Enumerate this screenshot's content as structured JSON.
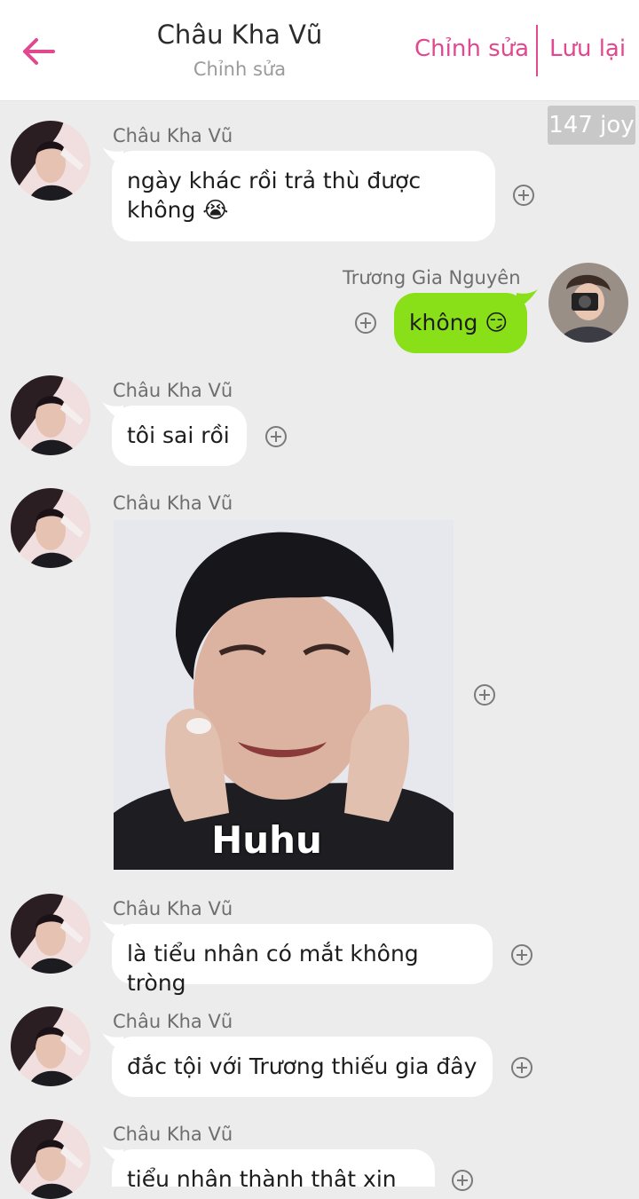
{
  "header": {
    "title": "Châu Kha Vũ",
    "subtitle": "Chỉnh sửa",
    "edit_label": "Chỉnh sửa",
    "save_label": "Lưu lại"
  },
  "joy_badge": "147 joy",
  "colors": {
    "accent": "#e0488f",
    "my_bubble": "#89e018",
    "background": "#ececec"
  },
  "messages": [
    {
      "sender": "Châu Kha Vũ",
      "text": "ngày khác rồi trả thù được không 😭"
    },
    {
      "sender": "Trương Gia Nguyên",
      "text": "không 😏"
    },
    {
      "sender": "Châu Kha Vũ",
      "text": "tôi sai rồi"
    },
    {
      "sender": "Châu Kha Vũ",
      "image_caption": "Huhu"
    },
    {
      "sender": "Châu Kha Vũ",
      "text": "là tiểu nhân có mắt không tròng"
    },
    {
      "sender": "Châu Kha Vũ",
      "text": "đắc tội với Trương thiếu gia đây"
    },
    {
      "sender": "Châu Kha Vũ",
      "text": "tiểu nhân thành thật xin lỗi"
    }
  ],
  "icons": {
    "back": "back-arrow-icon",
    "add": "plus-circle-icon"
  }
}
